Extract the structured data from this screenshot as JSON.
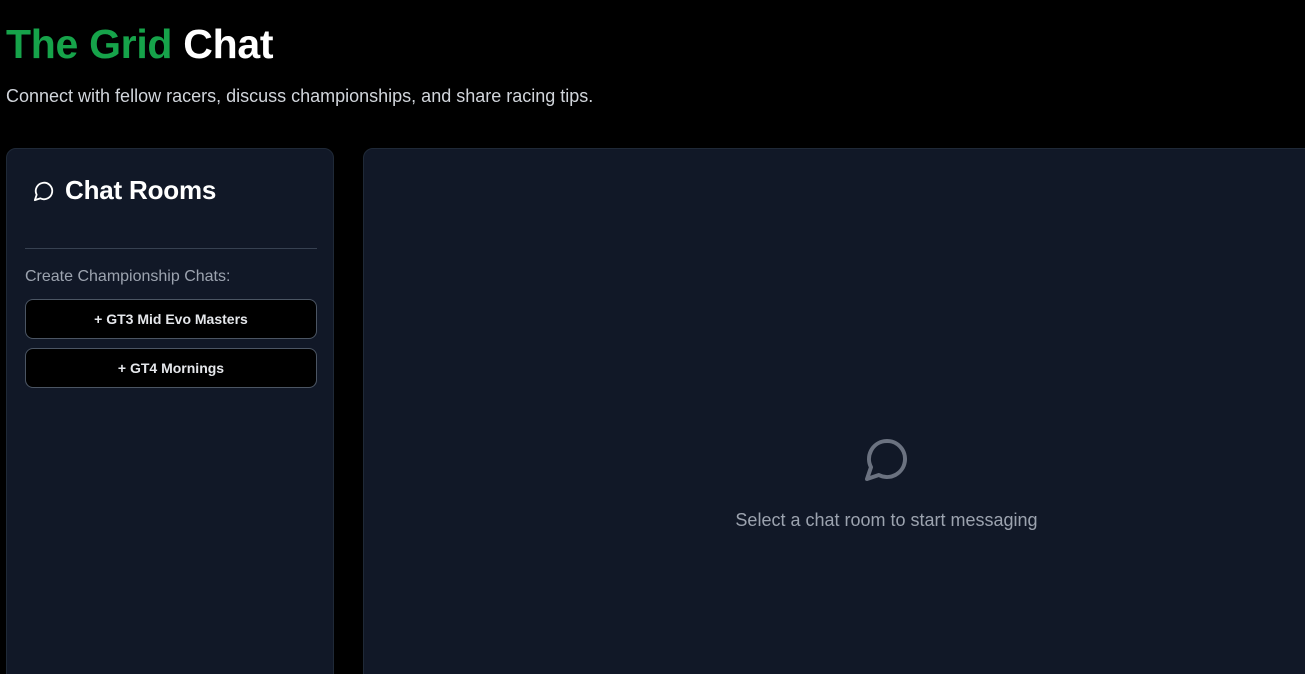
{
  "header": {
    "title_accent": "The Grid",
    "title_rest": "Chat",
    "subtitle": "Connect with fellow racers, discuss championships, and share racing tips."
  },
  "sidebar": {
    "icon": "message-circle-icon",
    "title": "Chat Rooms",
    "section_label": "Create Championship Chats:",
    "buttons": [
      {
        "label": "+ GT3 Mid Evo Masters"
      },
      {
        "label": "+ GT4 Mornings"
      }
    ]
  },
  "main": {
    "empty_icon": "message-circle-icon",
    "empty_text": "Select a chat room to start messaging"
  },
  "colors": {
    "accent": "#16a34a",
    "panel_bg": "#111827",
    "page_bg": "#000000"
  }
}
